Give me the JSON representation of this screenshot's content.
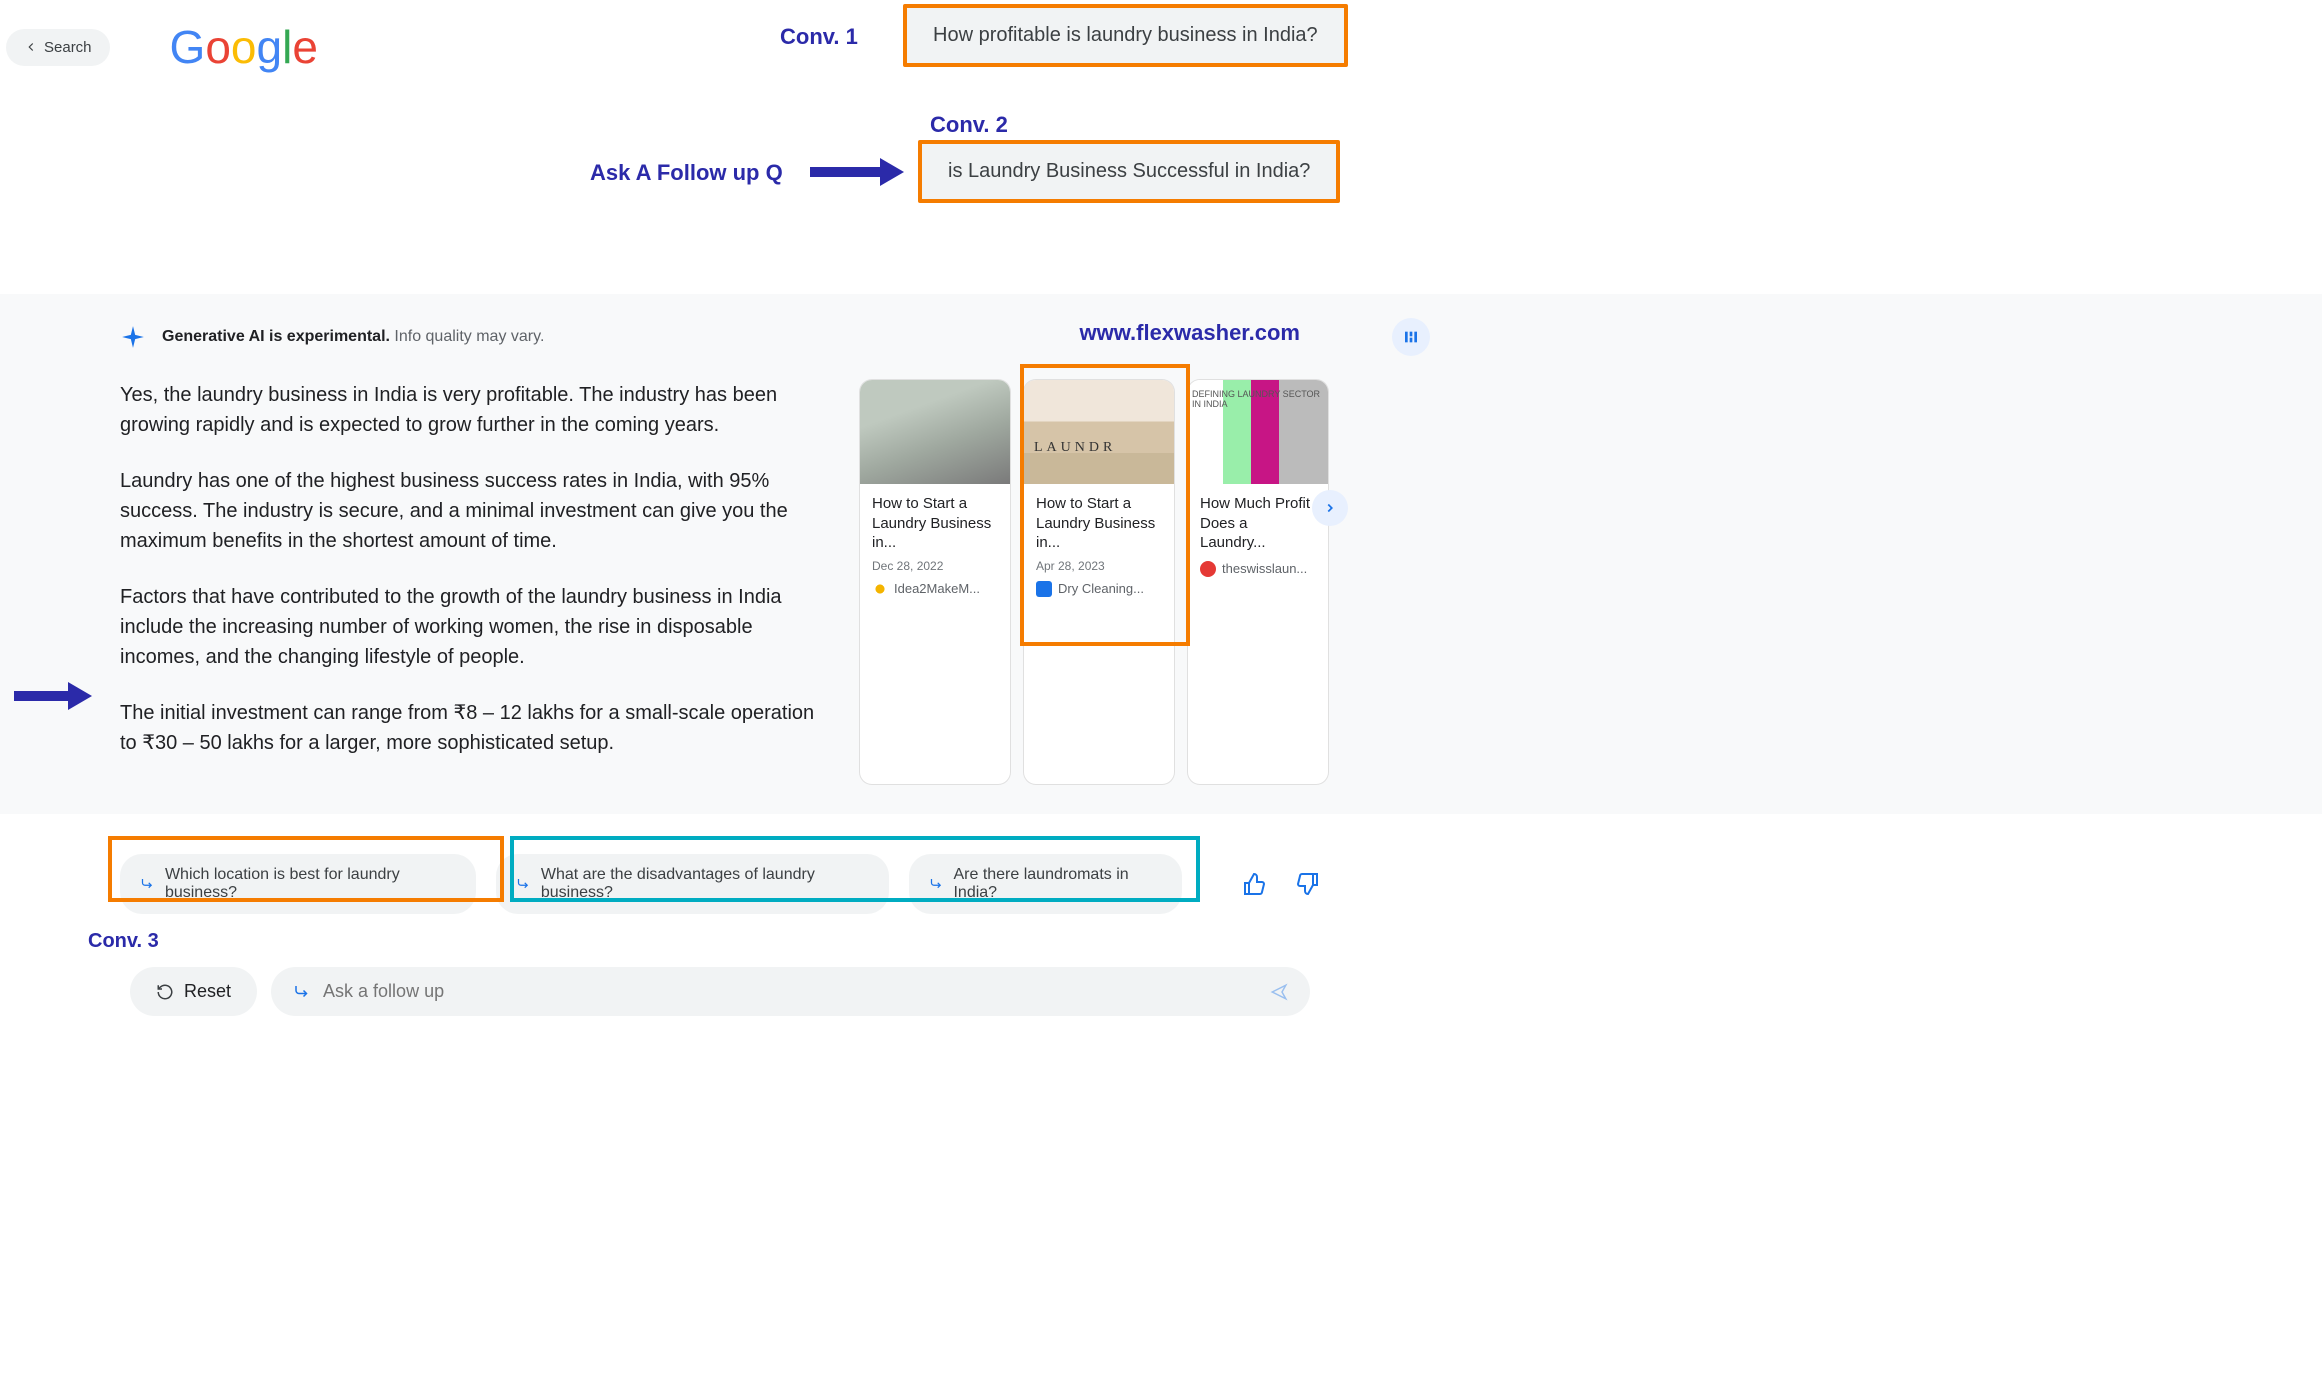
{
  "header": {
    "back_label": "Search",
    "logo_letters": [
      "G",
      "o",
      "o",
      "g",
      "l",
      "e"
    ]
  },
  "annotations": {
    "conv1": "Conv. 1",
    "conv2": "Conv. 2",
    "conv3": "Conv. 3",
    "follow_label": "Ask A Follow up Q",
    "watermark": "www.flexwasher.com"
  },
  "queries": {
    "q1": "How profitable is laundry business in India?",
    "q2": "is Laundry Business Successful in India?"
  },
  "gen_notice": {
    "bold": "Generative AI is experimental.",
    "rest": " Info quality may vary."
  },
  "answer": {
    "p1": "Yes, the laundry business in India is very profitable. The industry has been growing rapidly and is expected to grow further in the coming years.",
    "p2": "Laundry has one of the highest business success rates in India, with 95% success. The industry is secure, and a minimal investment can give you the maximum benefits in the shortest amount of time.",
    "p3": "Factors that have contributed to the growth of the laundry business in India include the increasing number of working women, the rise in disposable incomes, and the changing lifestyle of people.",
    "p4": "The initial investment can range from ₹8 – 12 lakhs for a small-scale operation to ₹30 – 50 lakhs for a larger, more sophisticated setup."
  },
  "cards": [
    {
      "title": "How to Start a Laundry Business in...",
      "date": "Dec 28, 2022",
      "source": "Idea2MakeM..."
    },
    {
      "title": "How to Start a Laundry Business in...",
      "date": "Apr 28, 2023",
      "source": "Dry Cleaning...",
      "block_text": "LAUNDR"
    },
    {
      "title": "How Much Profit Does a Laundry...",
      "date": "",
      "source": "theswisslaun...",
      "badge": "DEFINING\nLAUNDRY\nSECTOR IN\nINDIA"
    }
  ],
  "chips": [
    "Which location is best for laundry business?",
    "What are the disadvantages of laundry business?",
    "Are there laundromats in India?"
  ],
  "controls": {
    "reset": "Reset",
    "placeholder": "Ask a follow up"
  }
}
